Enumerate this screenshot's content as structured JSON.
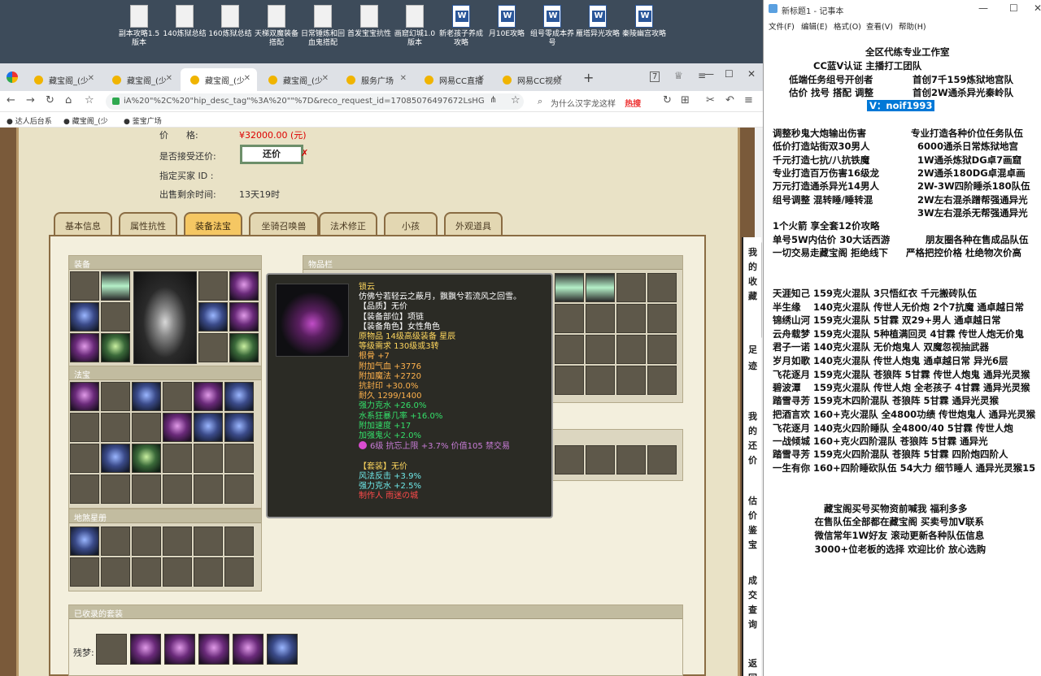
{
  "desktop": {
    "icons": [
      {
        "label": "副本攻略1.5版本",
        "type": "doc"
      },
      {
        "label": "140炼狱总结",
        "type": "doc"
      },
      {
        "label": "160炼狱总结",
        "type": "doc"
      },
      {
        "label": "天梯双魔装备搭配",
        "type": "doc"
      },
      {
        "label": "日常锤炼和回血鬼搭配",
        "type": "doc"
      },
      {
        "label": "首发宝宝抗性",
        "type": "doc"
      },
      {
        "label": "画窟幻城1.0版本",
        "type": "doc"
      },
      {
        "label": "新老孩子养成攻略",
        "type": "word"
      },
      {
        "label": "月10E攻略",
        "type": "word"
      },
      {
        "label": "组号零成本养号",
        "type": "word"
      },
      {
        "label": "雁塔异光攻略",
        "type": "word"
      },
      {
        "label": "秦陵幽宫攻略",
        "type": "word"
      }
    ]
  },
  "browser": {
    "tabs": [
      {
        "label": "藏宝阁_(少",
        "active": false
      },
      {
        "label": "藏宝阁_(少",
        "active": false
      },
      {
        "label": "藏宝阁_(少",
        "active": true
      },
      {
        "label": "藏宝阁_(少",
        "active": false
      },
      {
        "label": "服务广场",
        "active": false
      },
      {
        "label": "网易CC直播",
        "active": false
      },
      {
        "label": "网易CC视频",
        "active": false
      }
    ],
    "new_tab": "+",
    "tab_count": "7",
    "url": "iA%20\"%2C%20\"hip_desc_tag\"%3A%20\"\"%7D&reco_request_id=17085076497672LsHG",
    "search_placeholder": "为什么汉字龙这样",
    "search_hot": "热搜",
    "bookmarks": [
      "达人后台系",
      "藏宝阁_(少",
      "鉴宝广场"
    ]
  },
  "listing": {
    "price_label": "价　　格:",
    "price_value": "¥32000.00 (元)",
    "counter_label": "是否接受还价:",
    "counter_button": "还价",
    "buyer_label": "指定买家 ID :",
    "time_label": "出售剩余时间:",
    "time_value": "13天19时"
  },
  "content_tabs": [
    {
      "label": "基本信息",
      "active": false
    },
    {
      "label": "属性抗性",
      "active": false
    },
    {
      "label": "装备法宝",
      "active": true
    },
    {
      "label": "坐骑召唤兽",
      "active": false
    },
    {
      "label": "法术修正",
      "active": false
    },
    {
      "label": "小孩",
      "active": false
    },
    {
      "label": "外观道具",
      "active": false
    }
  ],
  "panels": {
    "equip": "装备",
    "fabao": "法宝",
    "dishu": "地煞星册",
    "items": "物品栏",
    "sets": "已收录的套装",
    "set_name": "残梦:"
  },
  "tooltip": {
    "lines": [
      {
        "text": "锁云",
        "cls": "l-name"
      },
      {
        "text": "仿佛兮若轻云之蔽月，飘飘兮若流风之回雪。",
        "cls": "l-desc"
      },
      {
        "text": "【品质】无价",
        "cls": "l-white"
      },
      {
        "text": "【装备部位】项链",
        "cls": "l-white"
      },
      {
        "text": "【装备角色】女性角色",
        "cls": "l-white"
      },
      {
        "text": "原物品 14级高级装备 星辰",
        "cls": "l-yellow"
      },
      {
        "text": "等级需求 130级或3转",
        "cls": "l-yellow"
      },
      {
        "text": "根骨 +7",
        "cls": "l-orange"
      },
      {
        "text": "附加气血 +3776",
        "cls": "l-orange"
      },
      {
        "text": "附加魔法 +2720",
        "cls": "l-orange"
      },
      {
        "text": "抗封印 +30.0%",
        "cls": "l-orange"
      },
      {
        "text": "耐久 1299/1400",
        "cls": "l-orange"
      },
      {
        "text": "强力克水 +26.0%",
        "cls": "l-green"
      },
      {
        "text": "水系狂暴几率 +16.0%",
        "cls": "l-green"
      },
      {
        "text": "附加速度 +17",
        "cls": "l-green"
      },
      {
        "text": "加强鬼火 +2.0%",
        "cls": "l-green"
      },
      {
        "text": "6级 抗忘上限 +3.7% 价值105 禁交易",
        "cls": "l-gem",
        "gem": true
      },
      {
        "text": "",
        "cls": "l-white"
      },
      {
        "text": "【套装】无价",
        "cls": "l-yellow"
      },
      {
        "text": "风法反击 +3.9%",
        "cls": "l-cyan"
      },
      {
        "text": "强力克水 +2.5%",
        "cls": "l-cyan"
      },
      {
        "text": "制作人 雨迷の城",
        "cls": "l-red"
      }
    ]
  },
  "notepad": {
    "title": "新标题1 - 记事本",
    "menu": [
      "文件(F)",
      "编辑(E)",
      "格式(O)",
      "查看(V)",
      "帮助(H)"
    ],
    "lines": [
      {
        "l": "全区代练专业工作室",
        "r": ""
      },
      {
        "l": "CC蓝V认证 主播打工团队",
        "r": ""
      },
      {
        "l": "低端任务组号开创者",
        "r": "首创7千159炼狱地宫队"
      },
      {
        "l": "估价 找号 搭配 调整",
        "r": "首创2W通杀异光秦岭队"
      },
      {
        "l": "V：noif1993",
        "r": "",
        "sel": true
      },
      {
        "l": "调整秒鬼大炮输出伤害",
        "r": "专业打造各种价位任务队伍"
      },
      {
        "l": "低价打造站街双30男人",
        "r": "6000通杀日常炼狱地宫"
      },
      {
        "l": "千元打造七抗/八抗铁魔",
        "r": "1W通杀炼狱DG卓7画窟"
      },
      {
        "l": "专业打造百万伤害16级龙",
        "r": "2W通杀180DG卓混卓画"
      },
      {
        "l": "万元打造通杀异光14男人",
        "r": "2W-3W四阶睡杀180队伍"
      },
      {
        "l": "组号调整 混转睡/睡转混",
        "r": "2W左右混杀蹭帮强通异光"
      },
      {
        "l": "",
        "r": "3W左右混杀无帮强通异光"
      },
      {
        "l": "1个火箭 享全套12价攻略",
        "r": ""
      },
      {
        "l": "单号5W内估价 30大话西游",
        "r": "朋友圈各种在售成品队伍"
      },
      {
        "l": "一切交易走藏宝阁 拒绝线下",
        "r": "严格把控价格 杜绝物次价高"
      },
      {
        "l": "天涯知己 159克火混队 3只悟红衣 千元搬砖队伍",
        "r": ""
      },
      {
        "l": "半生缘　 140克火混队 传世人无价炮 2个7抗魔 通卓越日常",
        "r": ""
      },
      {
        "l": "锦绣山河 159克火混队 5甘霖 双29+男人 通卓越日常",
        "r": ""
      },
      {
        "l": "云舟载梦 159克火混队 5种植满回灵 4甘霖 传世人炮无价鬼",
        "r": ""
      },
      {
        "l": "君子一诺 140克火混队 无价炮鬼人 双魔忽视抽武器",
        "r": ""
      },
      {
        "l": "岁月如歌 140克火混队 传世人炮鬼 通卓越日常 异光6层",
        "r": ""
      },
      {
        "l": "飞花逐月 159克火混队 苍狼阵 5甘霖 传世人炮鬼 通异光灵猴",
        "r": ""
      },
      {
        "l": "碧波潭　 159克火混队 传世人炮 全老孩子 4甘霖 通异光灵猴",
        "r": ""
      },
      {
        "l": "踏雪寻芳 159克木四阶混队 苍狼阵 5甘霖 通异光灵猴",
        "r": ""
      },
      {
        "l": "把酒言欢 160+克火混队 全4800功绩 传世炮鬼人 通异光灵猴",
        "r": ""
      },
      {
        "l": "飞花逐月 140克火四阶睡队 全4800/40 5甘霖 传世人炮",
        "r": ""
      },
      {
        "l": "一战倾城 160+克火四阶混队 苍狼阵 5甘霖 通异光",
        "r": ""
      },
      {
        "l": "踏雪寻芳 159克火四阶混队 苍狼阵 5甘霖 四阶炮四阶人",
        "r": ""
      },
      {
        "l": "一生有你 160+四阶睡砍队伍 54大力 细节睡人 通异光灵猴15",
        "r": ""
      },
      {
        "l": "　　藏宝阁买号买物资前喊我 福利多多",
        "r": ""
      },
      {
        "l": "　在售队伍全部都在藏宝阁 买卖号加V联系",
        "r": ""
      },
      {
        "l": "　微信常年1W好友 滚动更新各种队伍信息",
        "r": ""
      },
      {
        "l": "　3000+位老板的选择 欢迎比价 放心选购",
        "r": ""
      }
    ]
  },
  "side_chars": [
    "我",
    "的",
    "收",
    "藏",
    "足",
    "迹",
    "我",
    "的",
    "还",
    "价",
    "估",
    "价",
    "鉴",
    "宝",
    "成",
    "交",
    "查",
    "询",
    "返",
    "回"
  ]
}
